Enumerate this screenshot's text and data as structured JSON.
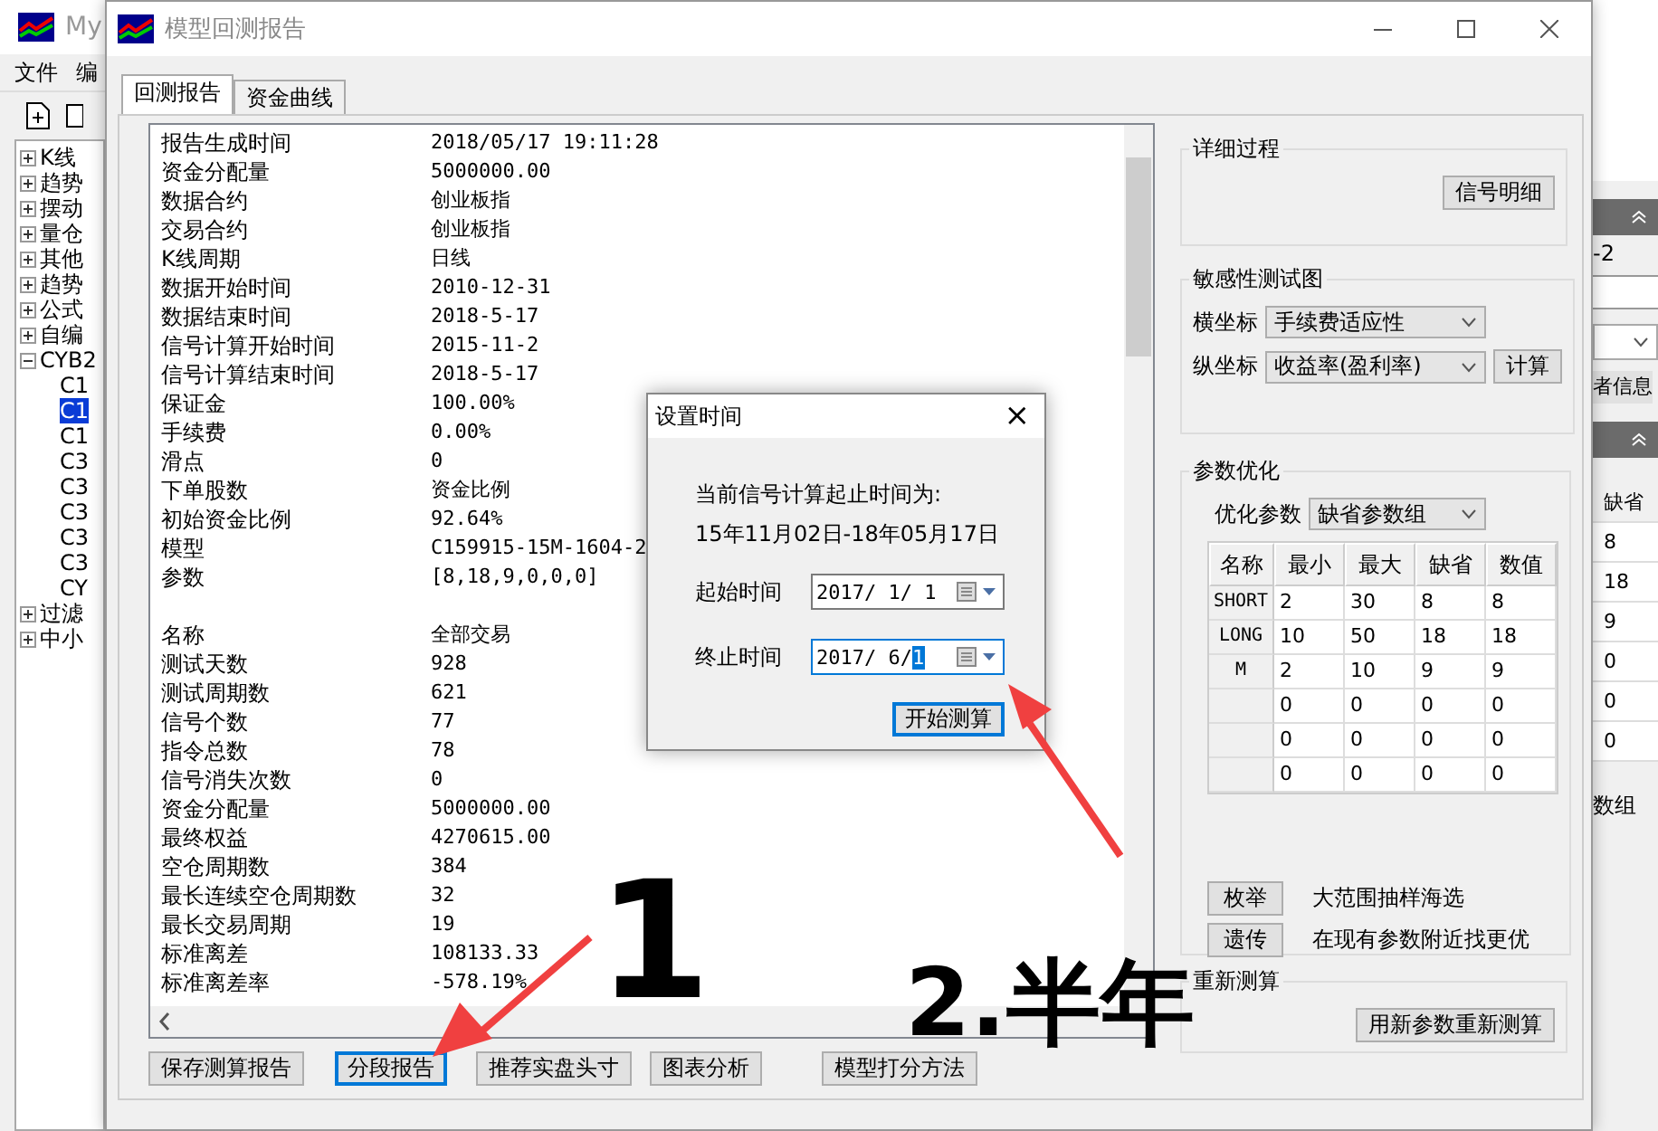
{
  "back_window": {
    "title": "My",
    "menu": [
      "文件",
      "编"
    ],
    "tree": [
      {
        "label": "K线",
        "expanded": false
      },
      {
        "label": "趋势",
        "expanded": false
      },
      {
        "label": "摆动",
        "expanded": false
      },
      {
        "label": "量仓",
        "expanded": false
      },
      {
        "label": "其他",
        "expanded": false
      },
      {
        "label": "趋势",
        "expanded": false
      },
      {
        "label": "公式",
        "expanded": false
      },
      {
        "label": "自编",
        "expanded": false
      },
      {
        "label": "CYB2",
        "expanded": true,
        "children": [
          {
            "label": "C1",
            "selected": false
          },
          {
            "label": "C1",
            "selected": true
          },
          {
            "label": "C1",
            "selected": false
          },
          {
            "label": "C3",
            "selected": false
          },
          {
            "label": "C3",
            "selected": false
          },
          {
            "label": "C3",
            "selected": false
          },
          {
            "label": "C3",
            "selected": false
          },
          {
            "label": "C3",
            "selected": false
          },
          {
            "label": "CY",
            "selected": false
          }
        ]
      },
      {
        "label": "过滤",
        "expanded": false
      },
      {
        "label": "中小",
        "expanded": false
      }
    ],
    "side": {
      "field_text": "-2",
      "button": "者信息",
      "column": "缺省",
      "values": [
        "8",
        "18",
        "9",
        "0",
        "0",
        "0"
      ],
      "footer": "数组"
    }
  },
  "window": {
    "title": "模型回测报告"
  },
  "tabs": [
    {
      "label": "回测报告",
      "selected": true
    },
    {
      "label": "资金曲线",
      "selected": false
    }
  ],
  "report_sections": [
    [
      [
        "报告生成时间",
        "2018/05/17 19:11:28"
      ],
      [
        "资金分配量",
        "5000000.00"
      ],
      [
        "数据合约",
        "创业板指"
      ],
      [
        "交易合约",
        "创业板指"
      ],
      [
        "K线周期",
        "日线"
      ],
      [
        "数据开始时间",
        "2010-12-31"
      ],
      [
        "数据结束时间",
        "2018-5-17"
      ],
      [
        "信号计算开始时间",
        "2015-11-2"
      ],
      [
        "信号计算结束时间",
        "2018-5-17"
      ],
      [
        "保证金",
        "100.00%"
      ],
      [
        "手续费",
        "0.00%"
      ],
      [
        "滑点",
        "0"
      ],
      [
        "下单股数",
        "资金比例"
      ],
      [
        "初始资金比例",
        "92.64%"
      ],
      [
        "模型",
        "C159915-15M-1604-2"
      ],
      [
        "参数",
        "[8,18,9,0,0,0]"
      ]
    ],
    [
      [
        "名称",
        "全部交易"
      ],
      [
        "测试天数",
        "928"
      ],
      [
        "测试周期数",
        "621"
      ],
      [
        "信号个数",
        "77"
      ],
      [
        "指令总数",
        "78"
      ],
      [
        "信号消失次数",
        "0"
      ],
      [
        "资金分配量",
        "5000000.00"
      ],
      [
        "最终权益",
        "4270615.00"
      ],
      [
        "空仓周期数",
        "384"
      ],
      [
        "最长连续空仓周期数",
        "32"
      ],
      [
        "最长交易周期",
        "19"
      ],
      [
        "标准离差",
        "108133.33"
      ],
      [
        "标准离差率",
        "-578.19%"
      ]
    ]
  ],
  "bottom_buttons": [
    {
      "label": "保存测算报告",
      "focused": false
    },
    {
      "label": "分段报告",
      "focused": true
    },
    {
      "label": "推荐实盘头寸",
      "focused": false
    },
    {
      "label": "图表分析",
      "focused": false
    },
    {
      "label": "模型打分方法",
      "focused": false
    }
  ],
  "detail": {
    "title": "详细过程",
    "button": "信号明细"
  },
  "sensitivity": {
    "title": "敏感性测试图",
    "x_label": "横坐标",
    "x_value": "手续费适应性",
    "y_label": "纵坐标",
    "y_value": "收益率(盈利率)",
    "button": "计算"
  },
  "optimize": {
    "title": "参数优化",
    "param_label": "优化参数",
    "param_value": "缺省参数组",
    "columns": [
      "名称",
      "最小",
      "最大",
      "缺省",
      "数值"
    ],
    "rows": [
      {
        "name": "SHORT",
        "cells": [
          "2",
          "30",
          "8",
          "8"
        ]
      },
      {
        "name": "LONG",
        "cells": [
          "10",
          "50",
          "18",
          "18"
        ]
      },
      {
        "name": "M",
        "cells": [
          "2",
          "10",
          "9",
          "9"
        ]
      },
      {
        "cells": [
          "0",
          "0",
          "0",
          "0"
        ]
      },
      {
        "cells": [
          "0",
          "0",
          "0",
          "0"
        ]
      },
      {
        "cells": [
          "0",
          "0",
          "0",
          "0"
        ]
      }
    ],
    "methods": [
      {
        "button": "枚举",
        "text": "大范围抽样海选"
      },
      {
        "button": "遗传",
        "text": "在现有参数附近找更优"
      }
    ]
  },
  "recalc": {
    "title": "重新测算",
    "button": "用新参数重新测算"
  },
  "dialog": {
    "title": "设置时间",
    "close": "×",
    "info": "当前信号计算起止时间为:",
    "range": "15年11月02日-18年05月17日",
    "fields": [
      {
        "label": "起始时间",
        "value": "2017/ 1/ 1",
        "focused": false
      },
      {
        "label": "终止时间",
        "value": "2017/ 6/",
        "selected_text": "1",
        "focused": true
      }
    ],
    "button": "开始测算"
  },
  "handwriting": [
    "1",
    "2.半年"
  ]
}
